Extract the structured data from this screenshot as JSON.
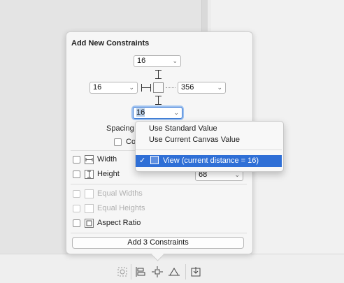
{
  "popover": {
    "title": "Add New Constraints",
    "top_value": "16",
    "left_value": "16",
    "right_value": "356",
    "bottom_value": "16",
    "spacing_label": "Spacing",
    "constrain_label": "Co",
    "width_label": "Width",
    "height_label": "Height",
    "height_value": "68",
    "equal_widths_label": "Equal Widths",
    "equal_heights_label": "Equal Heights",
    "aspect_ratio_label": "Aspect Ratio",
    "add_button_label": "Add 3 Constraints"
  },
  "menu": {
    "items": [
      "Use Standard Value",
      "Use Current Canvas Value"
    ],
    "selected_label": "View (current distance = 16)",
    "check": "✓"
  },
  "colors": {
    "accent": "#2f6fd6",
    "focus_ring": "#9dc1f0"
  },
  "toolbar": {
    "icons": [
      "update-frames-icon",
      "align-icon",
      "add-constraints-icon",
      "resolve-issues-icon",
      "embed-in-stack-icon"
    ]
  }
}
